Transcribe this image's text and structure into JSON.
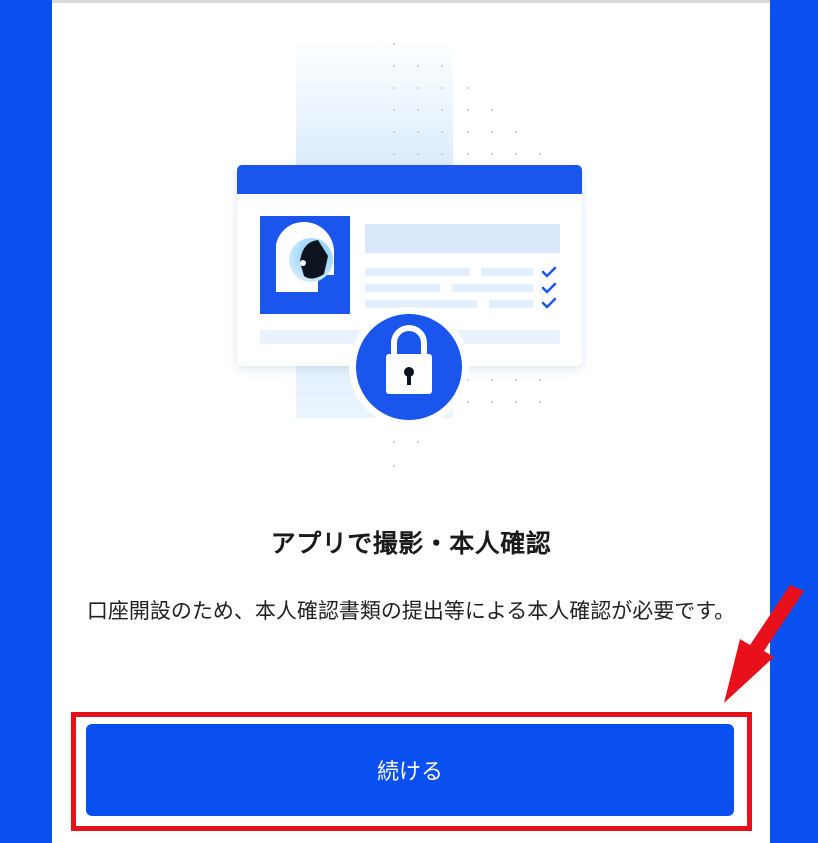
{
  "screen": {
    "title": "アプリで撮影・本人確認",
    "description": "口座開設のため、本人確認書類の提出等による本人確認が必要です。",
    "continue_label": "続ける"
  },
  "colors": {
    "brand_blue": "#0a4ff0",
    "highlight_red": "#e8101a"
  },
  "icons": [
    "id-card-illustration",
    "lock-icon",
    "checkmark-icon",
    "red-arrow-annotation"
  ]
}
